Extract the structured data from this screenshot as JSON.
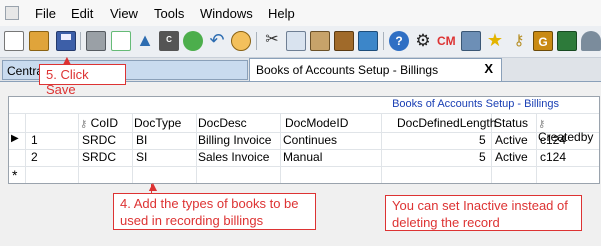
{
  "menu": [
    "File",
    "Edit",
    "View",
    "Tools",
    "Windows",
    "Help"
  ],
  "toolbar_icons": [
    "new-icon",
    "open-icon",
    "save-icon",
    "print-icon",
    "preview-icon",
    "up-icon",
    "calculator-icon",
    "refresh-icon",
    "undo-icon",
    "find-icon",
    "cut-icon",
    "copy-icon",
    "paste-icon",
    "grid-icon",
    "list-icon",
    "help-icon",
    "settings-icon",
    "cm-icon",
    "tools-icon",
    "favorite-icon",
    "key-icon",
    "g-icon",
    "paint-icon",
    "user-icon"
  ],
  "tabs": {
    "central": "Central M",
    "books": "Books  of Accounts Setup - Billings",
    "close": "X"
  },
  "grid": {
    "caption": "Books  of Accounts Setup - Billings",
    "columns": [
      "CoID",
      "DocType",
      "DocDesc",
      "DocModeID",
      "DocDefinedLength",
      "Status",
      "Createdby"
    ],
    "rows": [
      {
        "num": "1",
        "coid": "SRDC",
        "doctype": "BI",
        "docdesc": "Billing Invoice",
        "docmodeid": "Continues",
        "length": "5",
        "status": "Active",
        "createdby": "c124"
      },
      {
        "num": "2",
        "coid": "SRDC",
        "doctype": "SI",
        "docdesc": "Sales Invoice",
        "docmodeid": "Manual",
        "length": "5",
        "status": "Active",
        "createdby": "c124"
      }
    ],
    "new_row_marker": "*",
    "current_row_marker": "▶"
  },
  "annotations": {
    "save": "5. Click Save",
    "types": "4. Add the types of books to be used in recording billings",
    "inactive": "You can set Inactive instead of deleting the record"
  },
  "colors": {
    "annotation": "#d33333",
    "caption": "#1a3fb4",
    "tab_active": "#ffffff"
  }
}
